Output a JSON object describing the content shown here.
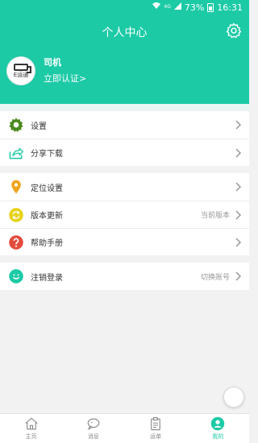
{
  "status": {
    "network": "4G",
    "battery": "73%",
    "time": "16:31"
  },
  "header": {
    "title": "个人中心",
    "settings_icon": "gear-icon"
  },
  "user": {
    "name": "司机",
    "verify_link": "立即认证>",
    "avatar_logo": "E运通"
  },
  "groups": [
    [
      {
        "label": "设置",
        "icon": "gear-icon",
        "color": "#4a8a1c"
      },
      {
        "label": "分享下载",
        "icon": "share-icon",
        "color": "#1ccaa6"
      }
    ],
    [
      {
        "label": "定位设置",
        "icon": "location-pin-icon",
        "color": "#f0a41f"
      },
      {
        "label": "版本更新",
        "icon": "refresh-icon",
        "color": "#e8d21a",
        "right_text": "当前版本"
      },
      {
        "label": "帮助手册",
        "icon": "question-icon",
        "color": "#e34b3d"
      }
    ],
    [
      {
        "label": "注销登录",
        "icon": "smile-icon",
        "color": "#1ccaa6",
        "right_text": "切换账号"
      }
    ]
  ],
  "tabs": [
    {
      "label": "主页",
      "icon": "home-icon"
    },
    {
      "label": "消息",
      "icon": "message-icon"
    },
    {
      "label": "运单",
      "icon": "clipboard-icon"
    },
    {
      "label": "我的",
      "icon": "user-icon",
      "active": true
    }
  ],
  "colors": {
    "brand": "#1ccaa6",
    "background": "#f2f2f2"
  }
}
